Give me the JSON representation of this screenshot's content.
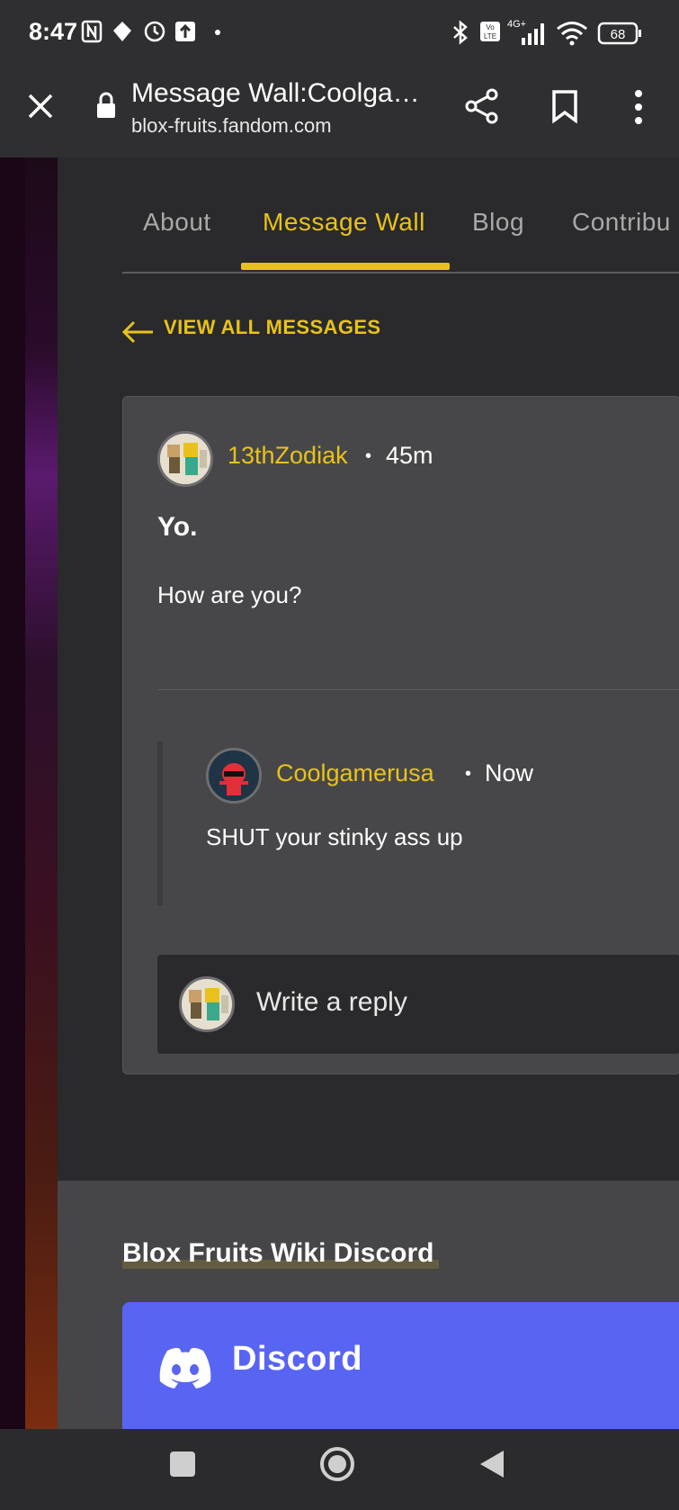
{
  "status_bar": {
    "time": "8:47",
    "battery": "68",
    "network": "4G+"
  },
  "browser": {
    "title": "Message Wall:Coolga…",
    "url": "blox-fruits.fandom.com"
  },
  "tabs": [
    {
      "label": "About"
    },
    {
      "label": "Message Wall"
    },
    {
      "label": "Blog"
    },
    {
      "label": "Contribu"
    }
  ],
  "view_all": "VIEW ALL MESSAGES",
  "post": {
    "author": "13thZodiak",
    "separator": "•",
    "time": "45m",
    "title": "Yo.",
    "body": "How are you?"
  },
  "reply": {
    "author": "Coolgamerusa",
    "separator": "•",
    "time": "Now",
    "body": "SHUT your stinky ass up"
  },
  "reply_box": {
    "placeholder": "Write a reply"
  },
  "discord": {
    "heading": "Blox Fruits Wiki Discord",
    "label": "Discord"
  },
  "colors": {
    "accent": "#e8c21b",
    "discord": "#5865f2",
    "card": "#474749"
  }
}
